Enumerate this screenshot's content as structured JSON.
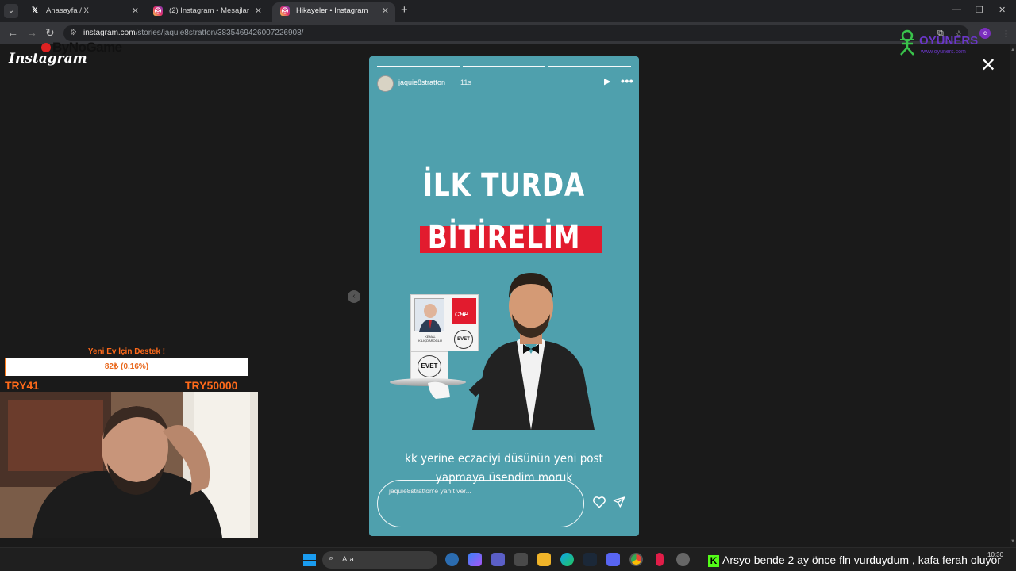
{
  "browser": {
    "tabs": [
      {
        "label": "Anasayfa / X",
        "favicon": "x-logo-icon"
      },
      {
        "label": "(2) Instagram • Mesajlar",
        "favicon": "instagram-icon"
      },
      {
        "label": "Hikayeler • Instagram",
        "favicon": "instagram-icon",
        "active": true
      }
    ],
    "url_host": "instagram.com",
    "url_path": "/stories/jaquie8stratton/3835469426007226908/",
    "profile_initial": "c"
  },
  "page": {
    "logo": "Instagram",
    "watermark_left": "ByNoGame",
    "watermark_right": "OYUNERS",
    "watermark_right_sub": "www.oyuners.com"
  },
  "story": {
    "username": "jaquie8stratton",
    "time": "11s",
    "progress_segments": 3,
    "headline_line1": "İLK TURDA",
    "headline_line2": "BİTİRELİM",
    "ballot_party": "CHP",
    "ballot_name_line1": "KEMAL",
    "ballot_name_line2": "KILIÇDAROĞLU",
    "stamp_text": "EVET",
    "caption_line1": "kk yerine eczaciyi düsünün yeni post",
    "caption_line2": "yapmaya üsendim moruk",
    "reply_placeholder": "jaquie8stratton'e yanıt ver...",
    "background_color": "#4fa0ad",
    "accent_red": "#e21b2e"
  },
  "donation": {
    "title": "Yeni Ev İçin Destek !",
    "progress_text": "82₺ (0.16%)",
    "progress_fraction": 0.0016,
    "min_label": "TRY41",
    "max_label": "TRY50000",
    "accent_color": "#ff6a1a"
  },
  "taskbar": {
    "search_label": "Ara",
    "ticker_user": "Arsyo",
    "ticker_message": "bende 2 ay önce fln vurduydum , kafa ferah oluyor",
    "clock": "10:30"
  }
}
